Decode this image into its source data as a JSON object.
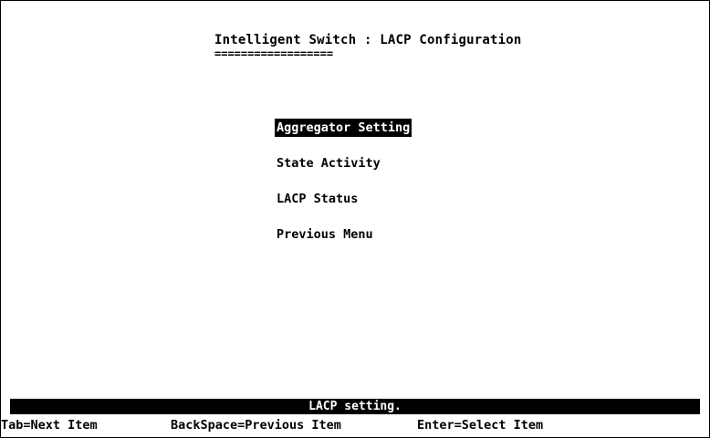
{
  "header": {
    "title": "Intelligent Switch : LACP Configuration",
    "underline": "=================="
  },
  "menu": {
    "items": [
      {
        "label": "Aggregator Setting",
        "selected": true
      },
      {
        "label": "State Activity",
        "selected": false
      },
      {
        "label": "LACP Status",
        "selected": false
      },
      {
        "label": "Previous Menu",
        "selected": false
      }
    ]
  },
  "status": {
    "message": "LACP setting."
  },
  "hints": {
    "tab": "Tab=Next Item",
    "backspace": "BackSpace=Previous Item",
    "enter": "Enter=Select Item"
  },
  "colors": {
    "background": "#ffffff",
    "foreground": "#000000",
    "highlight": "#000000"
  }
}
